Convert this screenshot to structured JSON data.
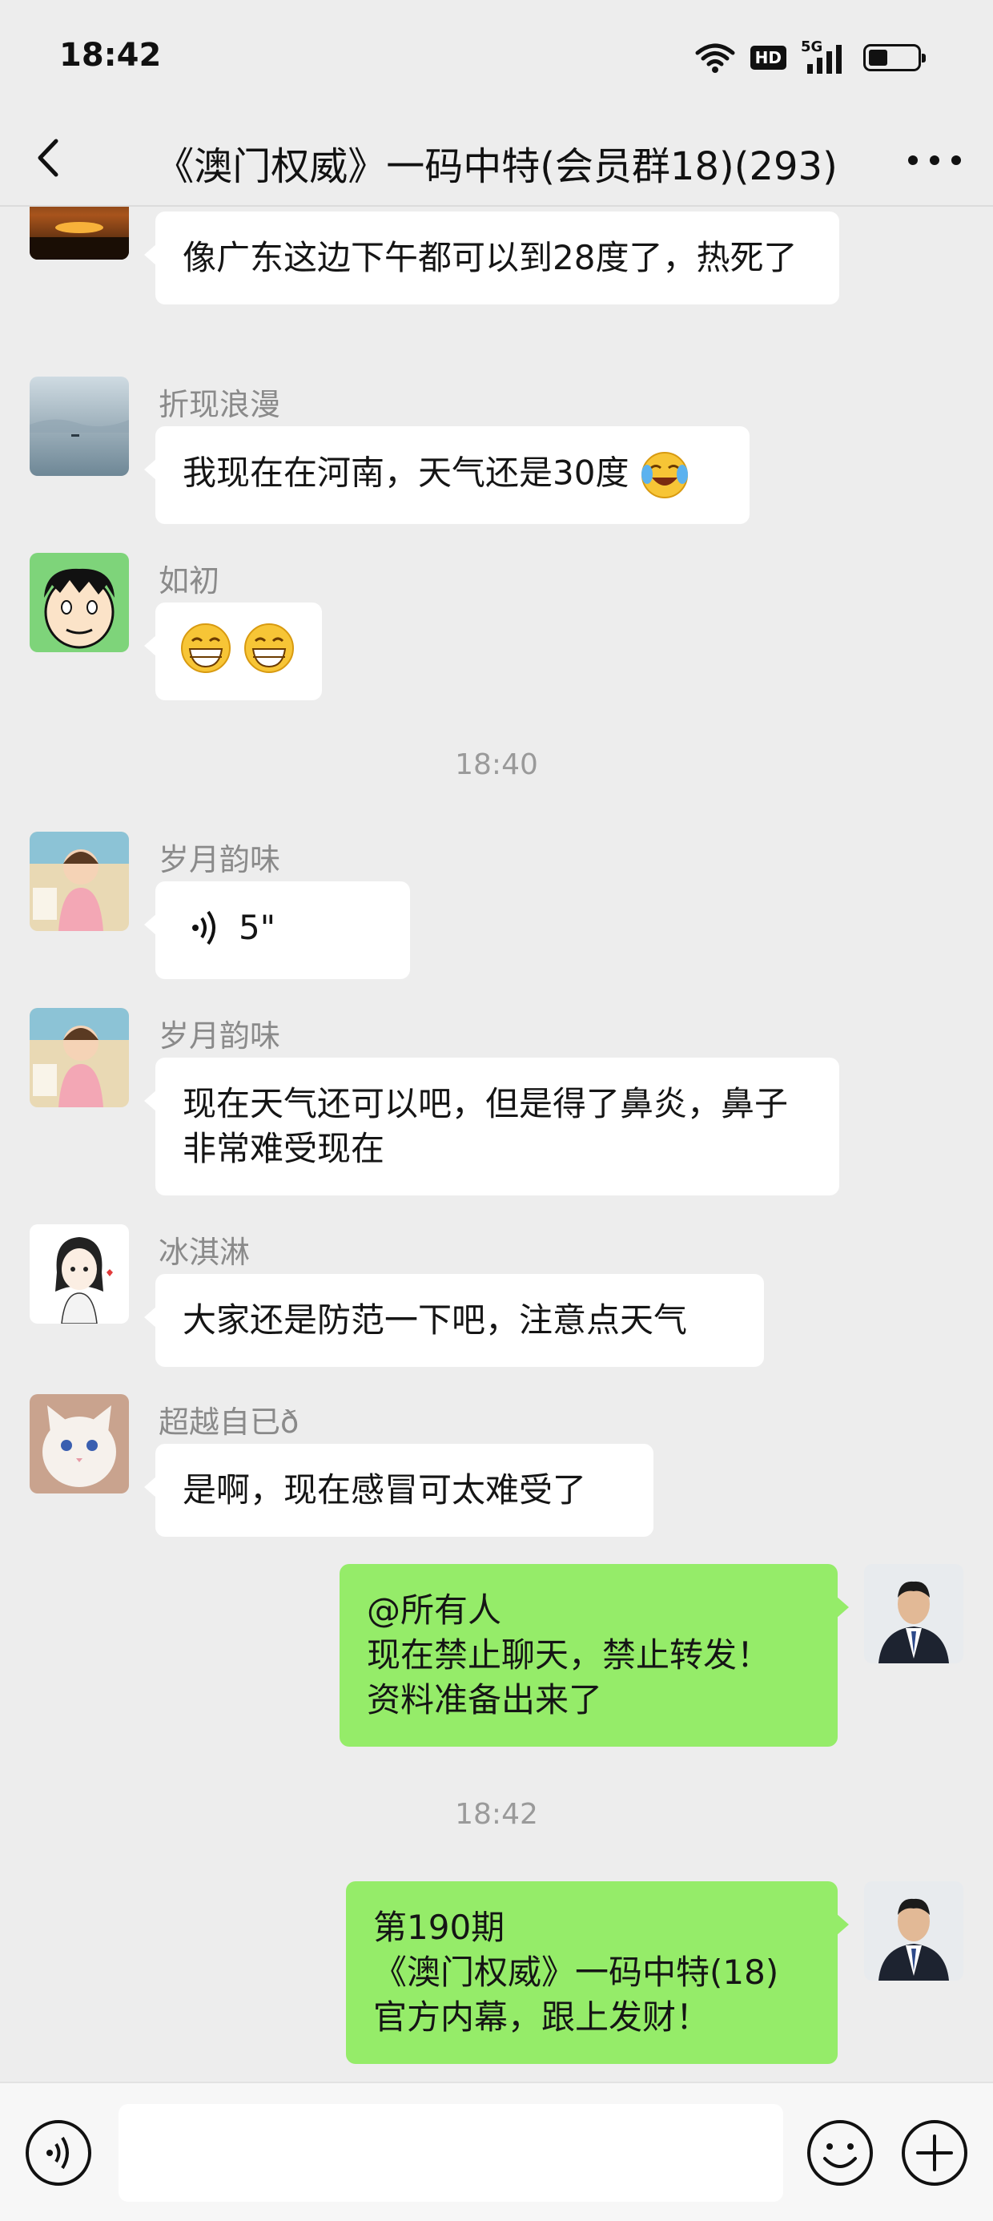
{
  "status_bar": {
    "time": "18:42",
    "network": "5G",
    "hd": "HD",
    "battery_level": 0.4
  },
  "nav": {
    "title": "《澳门权威》一码中特(会员群18)(293)"
  },
  "messages": [
    {
      "side": "left",
      "sender": "",
      "avatar": "sunset-avatar",
      "text": "像广东这边下午都可以到28度了，热死了"
    },
    {
      "side": "left",
      "sender": "折现浪漫",
      "avatar": "misty-lake-avatar",
      "text": "我现在在河南，天气还是30度",
      "emoji": "crying-laughing-emoji"
    },
    {
      "side": "left",
      "sender": "如初",
      "avatar": "cartoon-face-avatar",
      "emoji": "grinning-emoji x2"
    },
    {
      "type": "timestamp",
      "text": "18:40"
    },
    {
      "side": "left",
      "sender": "岁月韵味",
      "avatar": "child-avatar",
      "voice_duration": "5\""
    },
    {
      "side": "left",
      "sender": "岁月韵味",
      "avatar": "child-avatar",
      "text": "现在天气还可以吧，但是得了鼻炎，鼻子非常难受现在"
    },
    {
      "side": "left",
      "sender": "冰淇淋",
      "avatar": "sketch-girl-avatar",
      "text": "大家还是防范一下吧，注意点天气"
    },
    {
      "side": "left",
      "sender": "超越自已ð",
      "avatar": "white-cat-avatar",
      "text": "是啊，现在感冒可太难受了"
    },
    {
      "side": "right",
      "avatar": "suit-man-avatar",
      "lines": [
        "@所有人",
        "现在禁止聊天，禁止转发！",
        "资料准备出来了"
      ]
    },
    {
      "type": "timestamp",
      "text": "18:42"
    },
    {
      "side": "right",
      "avatar": "suit-man-avatar",
      "lines": [
        "第190期",
        "《澳门权威》一码中特(18)",
        "官方内幕，跟上发财！"
      ]
    }
  ],
  "input_bar": {
    "placeholder": ""
  },
  "colors": {
    "background": "#ededed",
    "own_bubble": "#95ec69",
    "other_bubble": "#ffffff"
  }
}
